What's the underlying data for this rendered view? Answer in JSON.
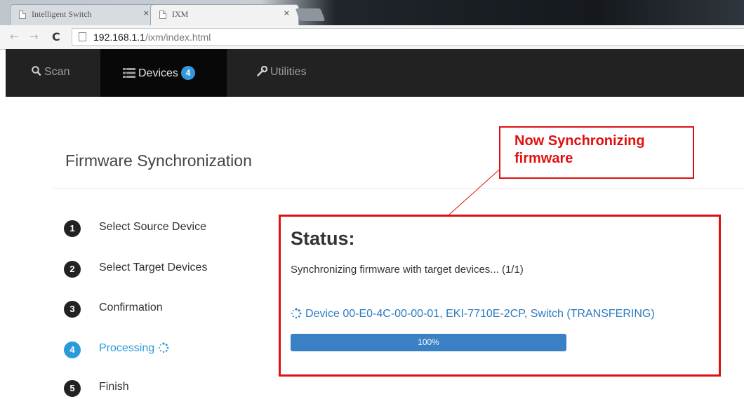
{
  "browser": {
    "tabs": [
      {
        "title": "Intelligent Switch",
        "close": "×",
        "active": false
      },
      {
        "title": "IXM",
        "close": "×",
        "active": true
      }
    ],
    "url_host": "192.168.1.1",
    "url_path": "/ixm/index.html"
  },
  "navbar": {
    "items": [
      {
        "label": "Scan",
        "icon": "search-icon"
      },
      {
        "label": "Devices",
        "icon": "list-icon",
        "badge": "4",
        "active": true
      },
      {
        "label": "Utilities",
        "icon": "wrench-icon"
      }
    ]
  },
  "page": {
    "title": "Firmware Synchronization"
  },
  "steps": [
    {
      "number": "1",
      "label": "Select Source Device"
    },
    {
      "number": "2",
      "label": "Select Target Devices"
    },
    {
      "number": "3",
      "label": "Confirmation"
    },
    {
      "number": "4",
      "label": "Processing",
      "current": true
    },
    {
      "number": "5",
      "label": "Finish"
    }
  ],
  "status": {
    "title": "Status:",
    "message": "Synchronizing firmware with target devices... (1/1)",
    "device": "Device 00-E0-4C-00-00-01, EKI-7710E-2CP, Switch (TRANSFERING)",
    "progress_percent": 100,
    "progress_label": "100%"
  },
  "annotation": {
    "line1": "Now Synchronizing",
    "line2": "firmware"
  },
  "colors": {
    "accent": "#2a9bd8",
    "navbar": "#222222",
    "annotation": "#e01010",
    "progress": "#3a80c4"
  }
}
